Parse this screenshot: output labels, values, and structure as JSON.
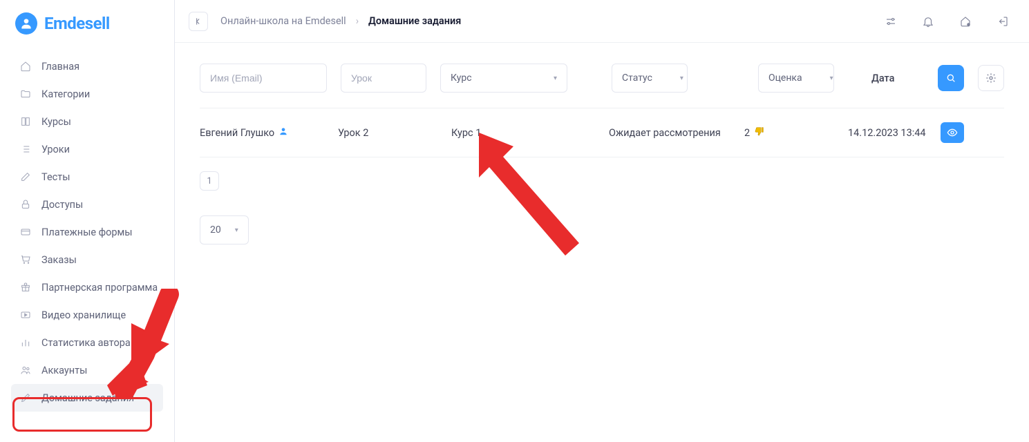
{
  "brand": "Emdesell",
  "sidebar": {
    "items": [
      {
        "label": "Главная",
        "icon": "home"
      },
      {
        "label": "Категории",
        "icon": "folder"
      },
      {
        "label": "Курсы",
        "icon": "book"
      },
      {
        "label": "Уроки",
        "icon": "list"
      },
      {
        "label": "Тесты",
        "icon": "edit"
      },
      {
        "label": "Доступы",
        "icon": "lock"
      },
      {
        "label": "Платежные формы",
        "icon": "card"
      },
      {
        "label": "Заказы",
        "icon": "cart"
      },
      {
        "label": "Партнерская программа",
        "icon": "gift"
      },
      {
        "label": "Видео хранилище",
        "icon": "video"
      },
      {
        "label": "Статистика автора",
        "icon": "bars"
      },
      {
        "label": "Аккаунты",
        "icon": "users"
      },
      {
        "label": "Домашние задания",
        "icon": "pencil"
      }
    ]
  },
  "breadcrumb": {
    "back_icon": "←|",
    "root": "Онлайн-школа на Emdesell",
    "current": "Домашние задания"
  },
  "filters": {
    "name_placeholder": "Имя (Email)",
    "lesson_placeholder": "Урок",
    "course_label": "Курс",
    "status_label": "Статус",
    "grade_label": "Оценка",
    "date_label": "Дата"
  },
  "rows": [
    {
      "name": "Евгений Глушко",
      "lesson": "Урок 2",
      "course": "Курс 1",
      "status": "Ожидает рассмотрения",
      "grade": "2",
      "date": "14.12.2023 13:44"
    }
  ],
  "pagination": {
    "current": "1",
    "page_size": "20"
  }
}
